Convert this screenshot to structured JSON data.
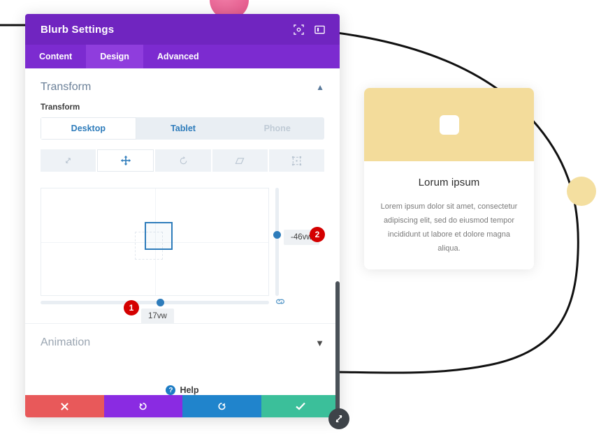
{
  "modal": {
    "title": "Blurb Settings",
    "header_icons": [
      {
        "name": "focus-target-icon",
        "label": "focus"
      },
      {
        "name": "layout-panel-icon",
        "label": "layout"
      }
    ],
    "tabs": [
      {
        "label": "Content",
        "active": false
      },
      {
        "label": "Design",
        "active": true
      },
      {
        "label": "Advanced",
        "active": false
      }
    ],
    "sections": {
      "transform": {
        "heading": "Transform",
        "field_label": "Transform",
        "devices": [
          {
            "label": "Desktop",
            "state": "active"
          },
          {
            "label": "Tablet",
            "state": "normal"
          },
          {
            "label": "Phone",
            "state": "disabled"
          }
        ],
        "modes": [
          {
            "name": "scale-icon",
            "active": false
          },
          {
            "name": "move-icon",
            "active": true
          },
          {
            "name": "rotate-icon",
            "active": false
          },
          {
            "name": "skew-icon",
            "active": false
          },
          {
            "name": "origin-icon",
            "active": false
          }
        ],
        "horizontal_value": "17vw",
        "vertical_value": "-46vw",
        "link_icon": "link-icon"
      },
      "animation": {
        "heading": "Animation"
      }
    },
    "help": {
      "label": "Help",
      "icon": "question-mark-icon"
    },
    "footer_buttons": [
      {
        "name": "cancel-button",
        "icon": "x-icon",
        "color": "#e8595a"
      },
      {
        "name": "undo-button",
        "icon": "undo-icon",
        "color": "#8a2be2"
      },
      {
        "name": "redo-button",
        "icon": "redo-icon",
        "color": "#2084cc"
      },
      {
        "name": "save-button",
        "icon": "check-icon",
        "color": "#3bbf9a"
      }
    ],
    "resize_handle": "resize-handle-icon"
  },
  "annotations": [
    {
      "number": "1",
      "target": "horizontal-slider"
    },
    {
      "number": "2",
      "target": "vertical-slider"
    }
  ],
  "preview_card": {
    "title": "Lorum ipsum",
    "body": "Lorem ipsum dolor sit amet, consectetur adipiscing elit, sed do eiusmod tempor incididunt ut labore et dolore magna aliqua.",
    "header_color": "#f3dc9b",
    "icon": "blurb-icon-placeholder"
  },
  "decorations": {
    "pink_circle": "#e75e90",
    "yellow_dot": "#f4dfa0",
    "curve_color": "#111111"
  },
  "colors": {
    "modal_header": "#7025c0",
    "tab_bar": "#7c2bd0",
    "tab_active": "#8f3ddd",
    "accent_blue": "#2e7cbb",
    "badge_red": "#d40000"
  }
}
